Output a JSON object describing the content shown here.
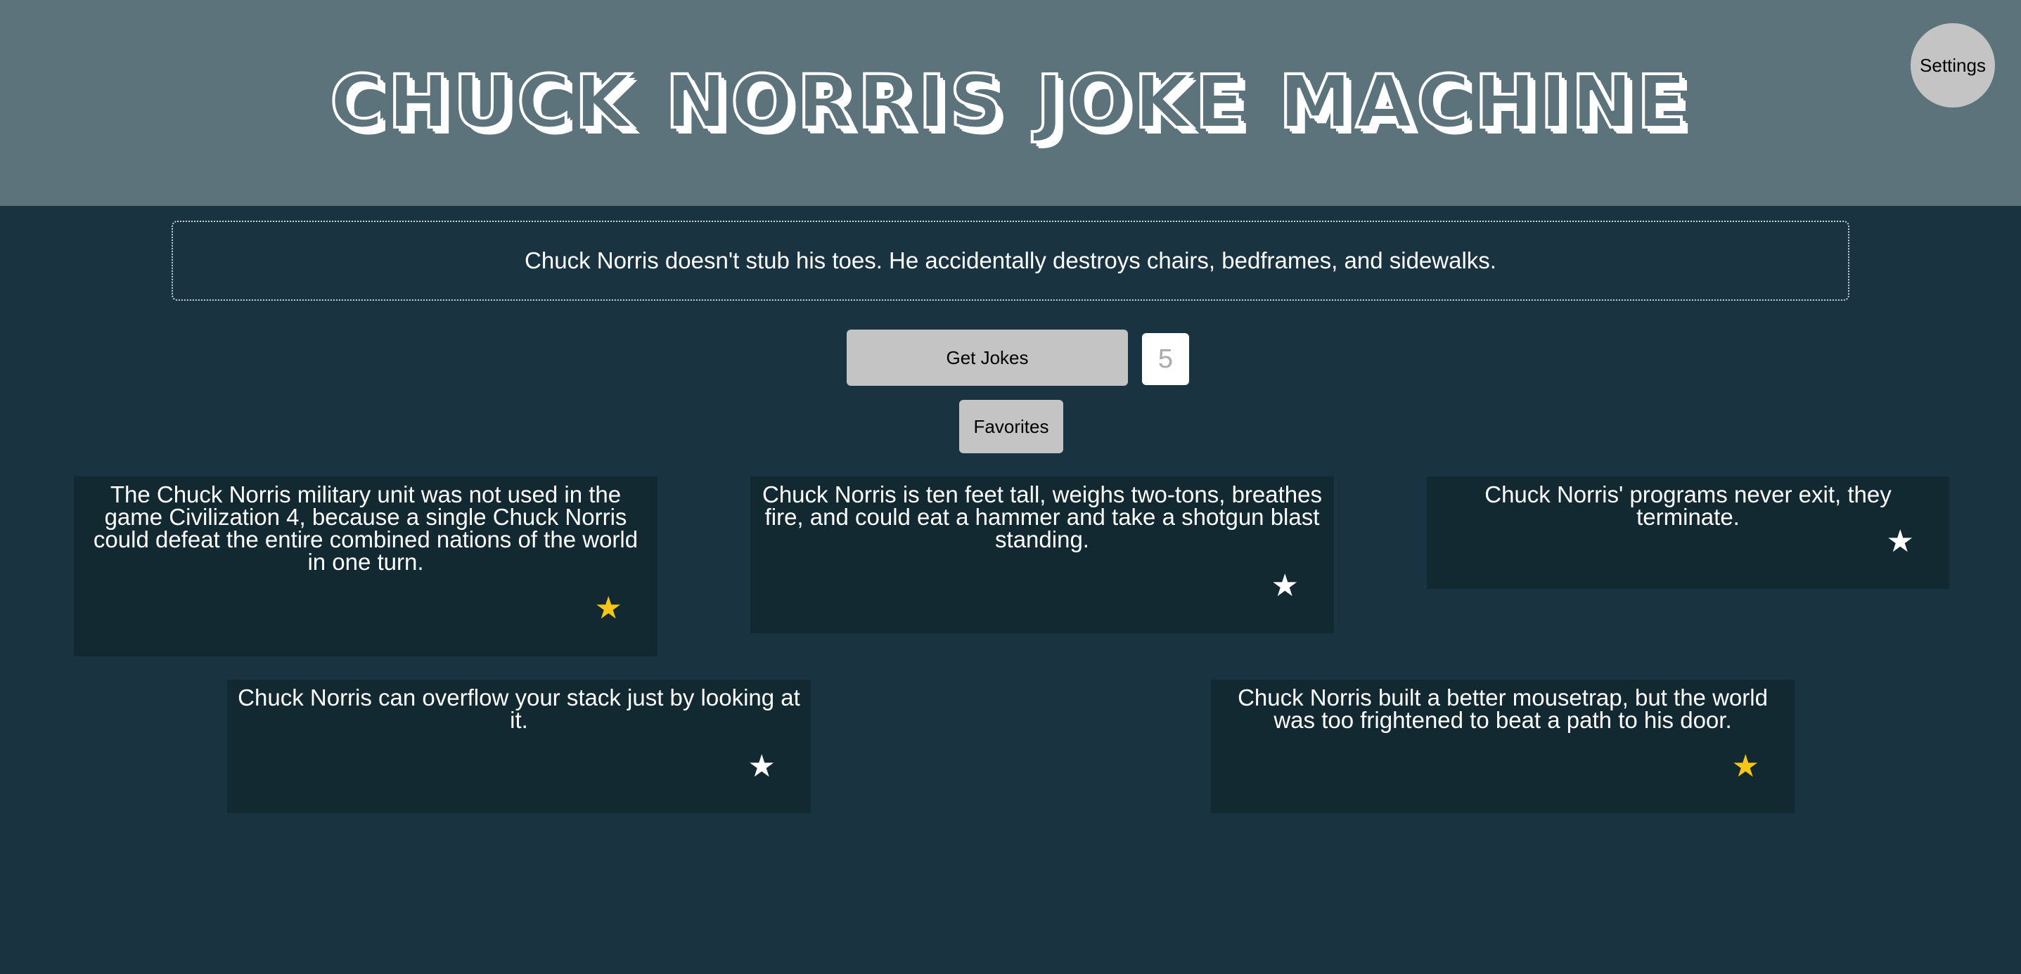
{
  "header": {
    "title": "CHUCK NORRIS JOKE MACHINE",
    "settings_label": "Settings"
  },
  "featured_joke": "Chuck Norris doesn't stub his toes. He accidentally destroys chairs, bedframes, and sidewalks.",
  "controls": {
    "get_jokes_label": "Get Jokes",
    "count_value": "5",
    "favorites_label": "Favorites"
  },
  "jokes": [
    {
      "text": "The Chuck Norris military unit was not used in the game Civilization 4, because a single Chuck Norris could defeat the entire combined nations of the world in one turn.",
      "favorite": true,
      "star": "★"
    },
    {
      "text": "Chuck Norris is ten feet tall, weighs two-tons, breathes fire, and could eat a hammer and take a shotgun blast standing.",
      "favorite": false,
      "star": "★"
    },
    {
      "text": "Chuck Norris' programs never exit, they terminate.",
      "favorite": false,
      "star": "★"
    },
    {
      "text": "Chuck Norris can overflow your stack just by looking at it.",
      "favorite": false,
      "star": "★"
    },
    {
      "text": "Chuck Norris built a better mousetrap, but the world was too frightened to beat a path to his door.",
      "favorite": true,
      "star": "★"
    }
  ],
  "colors": {
    "header_bg": "#5c737b",
    "page_bg": "#193340",
    "card_bg": "#132931",
    "button_bg": "#c4c4c4",
    "favorite_star": "#f5c518",
    "unfavorite_star": "#ffffff"
  }
}
